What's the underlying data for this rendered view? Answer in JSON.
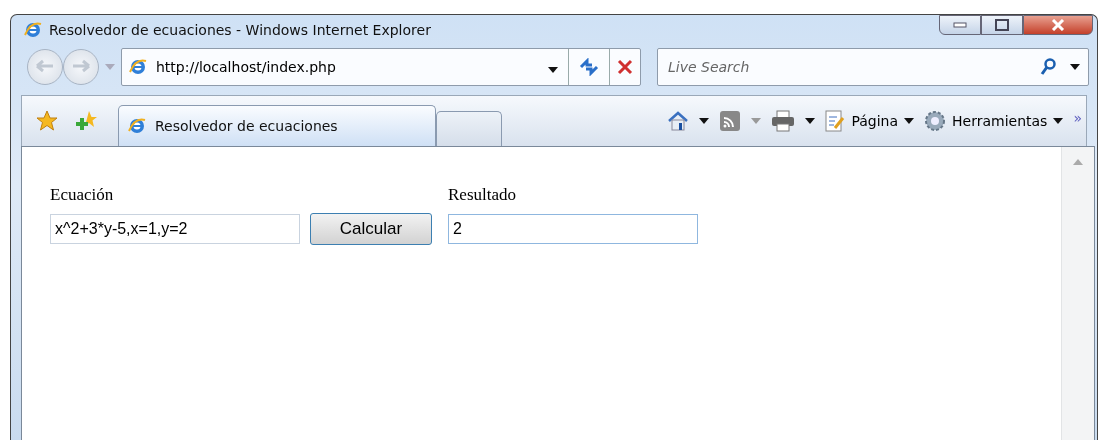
{
  "window": {
    "title": "Resolvedor de ecuaciones - Windows Internet Explorer"
  },
  "address_bar": {
    "value": "http://localhost/index.php"
  },
  "search": {
    "placeholder": "Live Search"
  },
  "tabs": [
    {
      "label": "Resolvedor de ecuaciones",
      "selected": true
    },
    {
      "selected": false
    }
  ],
  "command_bar": {
    "page_menu": "Página",
    "tools_menu": "Herramientas",
    "overflow": "»"
  },
  "page": {
    "equation_label": "Ecuación",
    "equation_value": "x^2+3*y-5,x=1,y=2",
    "button": "Calcular",
    "result_label": "Resultado",
    "result_value": "2"
  }
}
